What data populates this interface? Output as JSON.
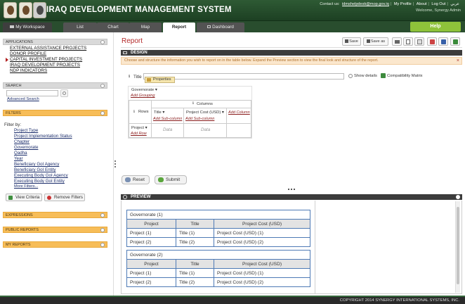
{
  "header": {
    "title": "IRAQ DEVELOPMENT MANAGEMENT SYSTEM",
    "contact_label": "Contact us:",
    "contact_email": "idmshelpdesk@mop.gov.iq",
    "links": [
      "My Profile",
      "About",
      "Log Out",
      "عربي"
    ],
    "welcome": "Welcome,  Synergy Admin"
  },
  "tabs": {
    "workspace": "My Workspace",
    "list": "List",
    "chart": "Chart",
    "map": "Map",
    "report": "Report",
    "dashboard": "Dashboard",
    "help": "Help"
  },
  "sidebar": {
    "applications_header": "APPLICATIONS",
    "applications": [
      "EXTERNAL ASSISTANCE PROJECTS",
      "DONOR PROFILE",
      "CAPITAL INVESTMENT PROJECTS",
      "IRAQ DEVELOPMENT PROJECTS",
      "NDP INDICATORS"
    ],
    "search_header": "SEARCH",
    "advanced_search": "Advanced Search",
    "filters_header": "FILTERS",
    "filter_by": "Filter by:",
    "filters": [
      "Project Type",
      "Project Implementation Status",
      "Chapter",
      "Governorate",
      "Qadha",
      "Year",
      "Beneficiary GoI Agency",
      "Beneficiary GoI Entity",
      "Executing Body GoI Agency",
      "Executing Body GoI Entity",
      "More Filters..."
    ],
    "view_criteria": "View Criteria",
    "remove_filters": "Remove Filters",
    "expressions_header": "EXPRESSIONS",
    "public_reports_header": "PUBLIC REPORTS",
    "my_reports_header": "MY REPORTS"
  },
  "main": {
    "page_title": "Report",
    "toolbar": {
      "save": "Save",
      "save_as": "Save as"
    },
    "design_bar": "DESIGN",
    "notice": "Choose and structure the information you wish to report on in the table below. Expand the Preview section to view the final look and structure of the report.",
    "title_label": "Title",
    "properties_label": "Properties",
    "show_details": "Show details",
    "compat_matrix": "Compatibility Matrix",
    "grouping_field": "Governorate",
    "add_grouping": "Add Grouping",
    "columns_label": "Columns",
    "rows_label": "Rows",
    "col_title": "Title",
    "col_cost": "Project Cost (USD)",
    "add_column": "Add Column",
    "add_subcolumn": "Add Sub-column",
    "row_project": "Project",
    "add_row": "Add Row",
    "data": "Data",
    "reset": "Reset",
    "submit": "Submit",
    "preview_bar": "PREVIEW",
    "preview_headers": [
      "Project",
      "Title",
      "Project Cost (USD)"
    ],
    "preview_groups": [
      {
        "label": "Governorate (1)",
        "rows": [
          [
            "Project (1)",
            "Title (1)",
            "Project Cost (USD) (1)"
          ],
          [
            "Project (2)",
            "Title (2)",
            "Project Cost (USD) (2)"
          ]
        ]
      },
      {
        "label": "Governorate (2)",
        "rows": [
          [
            "Project (1)",
            "Title (1)",
            "Project Cost (USD) (1)"
          ],
          [
            "Project (2)",
            "Title (2)",
            "Project Cost (USD) (2)"
          ]
        ]
      }
    ]
  },
  "footer": "COPYRIGHT 2014 SYNERGY INTERNATIONAL SYSTEMS, INC."
}
